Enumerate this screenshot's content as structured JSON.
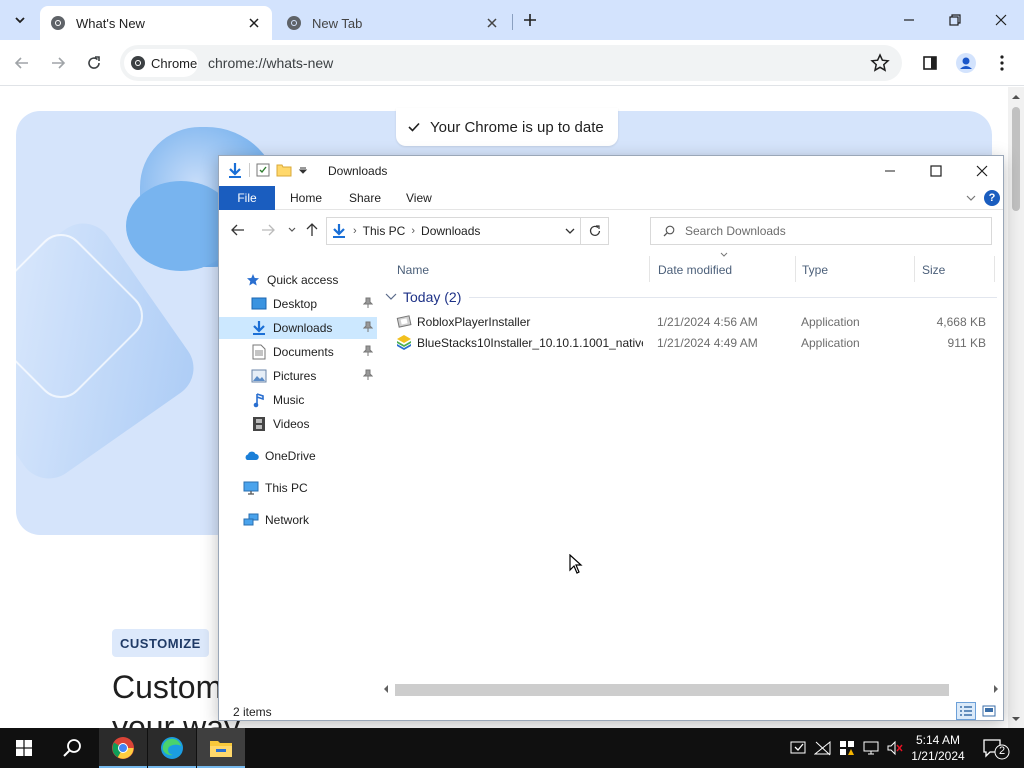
{
  "chrome": {
    "tabs": [
      {
        "title": "What's New",
        "active": true
      },
      {
        "title": "New Tab",
        "active": false
      }
    ],
    "chip_label": "Chrome",
    "url": "chrome://whats-new"
  },
  "page": {
    "banner_text": "Your Chrome is up to date",
    "chip": "CUSTOMIZE",
    "heading_line1": "Custom",
    "heading_line2": "your way"
  },
  "explorer": {
    "title": "Downloads",
    "ribbon_tabs": [
      "File",
      "Home",
      "Share",
      "View"
    ],
    "help_label": "?",
    "breadcrumb": [
      "This PC",
      "Downloads"
    ],
    "search_placeholder": "Search Downloads",
    "nav_pane": {
      "quick_access": "Quick access",
      "items": [
        {
          "label": "Desktop",
          "pinned": true
        },
        {
          "label": "Downloads",
          "pinned": true,
          "selected": true
        },
        {
          "label": "Documents",
          "pinned": true
        },
        {
          "label": "Pictures",
          "pinned": true
        },
        {
          "label": "Music",
          "pinned": false
        },
        {
          "label": "Videos",
          "pinned": false
        }
      ],
      "onedrive": "OneDrive",
      "this_pc": "This PC",
      "network": "Network"
    },
    "columns": [
      "Name",
      "Date modified",
      "Type",
      "Size"
    ],
    "group_label": "Today (2)",
    "files": [
      {
        "name": "RobloxPlayerInstaller",
        "date": "1/21/2024 4:56 AM",
        "type": "Application",
        "size": "4,668 KB",
        "icon": "roblox-installer-icon"
      },
      {
        "name": "BlueStacks10Installer_10.10.1.1001_native...",
        "date": "1/21/2024 4:49 AM",
        "type": "Application",
        "size": "911 KB",
        "icon": "bluestacks-installer-icon"
      }
    ],
    "status": "2 items"
  },
  "taskbar": {
    "time": "5:14 AM",
    "date": "1/21/2024",
    "notification_count": "2",
    "apps": [
      "chrome-icon",
      "edge-icon",
      "file-explorer-icon"
    ]
  },
  "colors": {
    "chrome_tabstrip": "#d3e3fd",
    "explorer_file_tab": "#1a5dbf",
    "nav_selected": "#cce8ff",
    "group_header": "#1e3287"
  }
}
